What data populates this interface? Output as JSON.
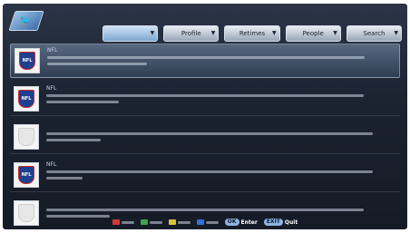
{
  "tabs": [
    {
      "label": "",
      "active": true
    },
    {
      "label": "Profile",
      "active": false
    },
    {
      "label": "Retimes",
      "active": false
    },
    {
      "label": "People",
      "active": false
    },
    {
      "label": "Search",
      "active": false
    }
  ],
  "tweets": [
    {
      "author": "NFL",
      "meta": "",
      "avatar": "NFL",
      "selected": true
    },
    {
      "author": "NFL",
      "meta": "",
      "avatar": "NFL",
      "selected": false
    },
    {
      "author": "",
      "meta": "",
      "avatar": "",
      "selected": false
    },
    {
      "author": "NFL",
      "meta": "",
      "avatar": "NFL",
      "selected": false
    },
    {
      "author": "",
      "meta": "",
      "avatar": "",
      "selected": false
    }
  ],
  "footer": {
    "ok_key": "OK",
    "ok_label": "Enter",
    "exit_key": "EXIT",
    "exit_label": "Quit"
  }
}
